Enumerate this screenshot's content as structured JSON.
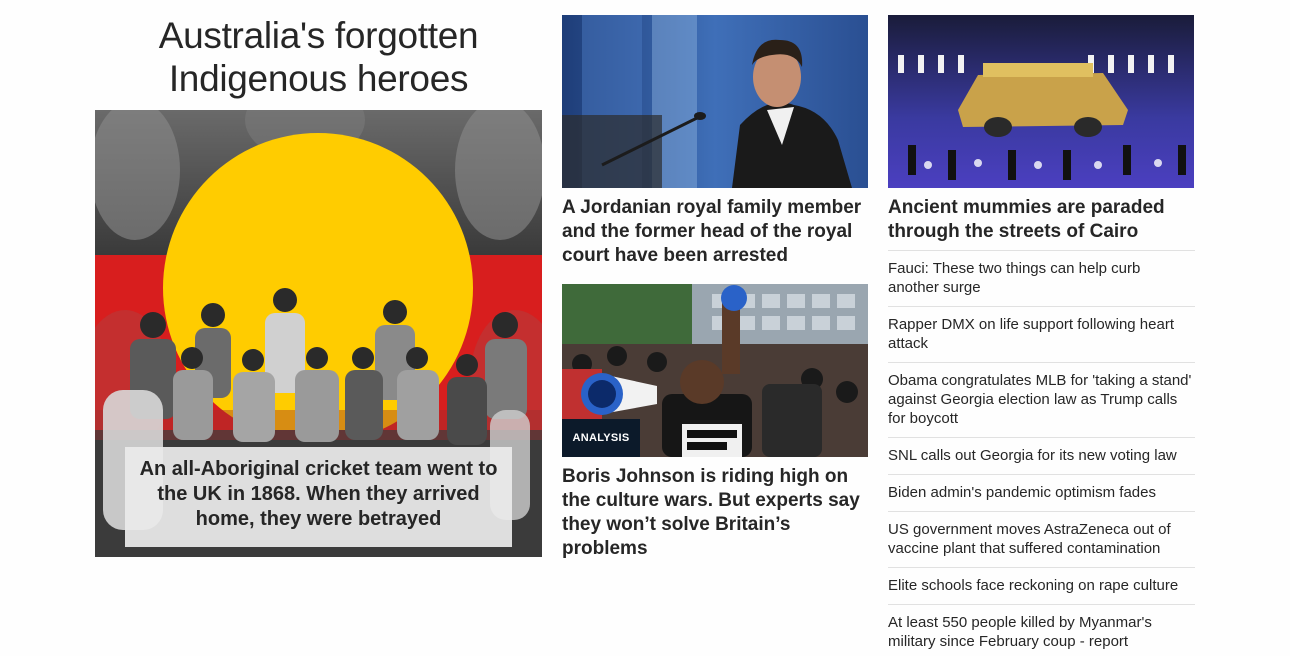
{
  "feature": {
    "title": "Australia's forgotten Indigenous heroes",
    "caption": "An all-Aboriginal cricket team went to the UK in 1868. When they arrived home, they were betrayed"
  },
  "middle": {
    "card1": {
      "headline": "A Jordanian royal family member and the former head of the royal court have been arrested"
    },
    "card2": {
      "badge": "ANALYSIS",
      "headline": "Boris Johnson is riding high on the culture wars. But experts say they won’t solve Britain’s problems"
    }
  },
  "right": {
    "lead": {
      "headline": "Ancient mummies are paraded through the streets of Cairo"
    },
    "headlines": [
      "Fauci: These two things can help curb another surge",
      "Rapper DMX on life support following heart attack",
      "Obama congratulates MLB for 'taking a stand' against Georgia election law as Trump calls for boycott",
      "SNL calls out Georgia for its new voting law",
      "Biden admin's pandemic optimism fades",
      "US government moves AstraZeneca out of vaccine plant that suffered contamination",
      "Elite schools face reckoning on rape culture",
      "At least 550 people killed by Myanmar's military since February coup - report"
    ]
  },
  "colors": {
    "text": "#262626",
    "flag_black": "#1a1a1a",
    "flag_red": "#d81e1e",
    "flag_yellow": "#ffcc00",
    "badge_bg": "#0c1a2a",
    "divider": "#e1e1e1"
  }
}
